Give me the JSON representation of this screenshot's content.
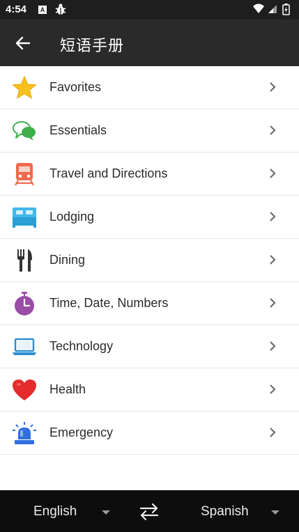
{
  "status_bar": {
    "time": "4:54",
    "notification_icons": [
      "accessibility-a-icon",
      "bug-icon"
    ],
    "system_icons": [
      "wifi-icon",
      "signal-icon",
      "battery-icon"
    ]
  },
  "app_bar": {
    "title": "短语手册",
    "back_icon": "arrow-left-icon"
  },
  "categories": [
    {
      "label": "Favorites",
      "icon": "star-icon"
    },
    {
      "label": "Essentials",
      "icon": "speech-bubbles-icon"
    },
    {
      "label": "Travel and Directions",
      "icon": "train-icon"
    },
    {
      "label": "Lodging",
      "icon": "bed-icon"
    },
    {
      "label": "Dining",
      "icon": "fork-knife-icon"
    },
    {
      "label": "Time, Date, Numbers",
      "icon": "stopwatch-icon"
    },
    {
      "label": "Technology",
      "icon": "laptop-icon"
    },
    {
      "label": "Health",
      "icon": "heart-icon"
    },
    {
      "label": "Emergency",
      "icon": "siren-icon"
    }
  ],
  "language_bar": {
    "source_language": "English",
    "target_language": "Spanish"
  },
  "colors": {
    "status_bar": "#1e1e1e",
    "app_bar": "#2a2a2a",
    "language_bar": "#0d0d0d",
    "star": "#f7c11d",
    "essentials": "#3fae4a",
    "train": "#ef6a4c",
    "bed": "#42b8ea",
    "stopwatch": "#9a4ca6",
    "laptop": "#2f8fd0",
    "heart": "#e52b2b",
    "siren": "#2f6ee0"
  }
}
